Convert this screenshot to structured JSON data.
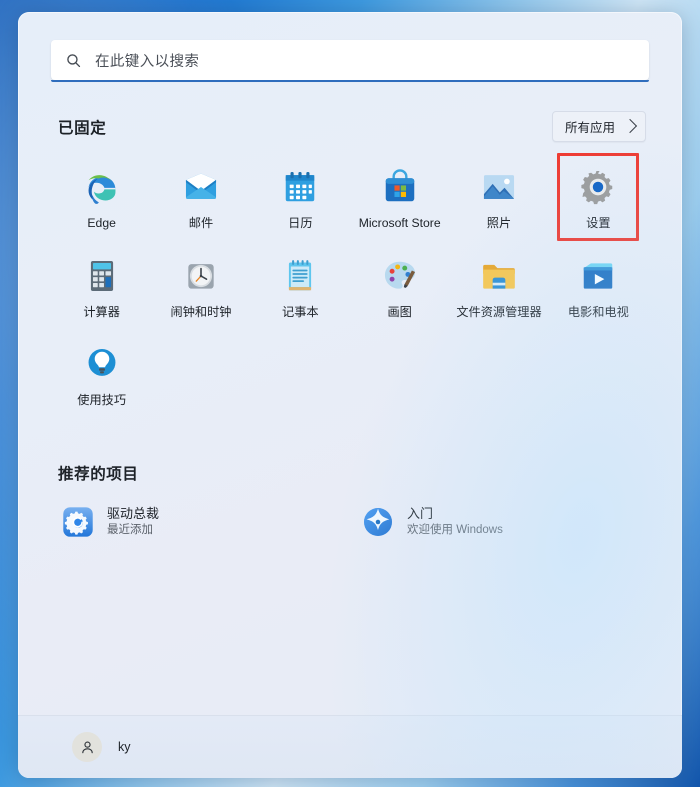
{
  "search": {
    "placeholder": "在此键入以搜索",
    "icon": "search-icon"
  },
  "pinned": {
    "title": "已固定",
    "all_apps_label": "所有应用",
    "all_apps_chevron": "chevron-right-icon",
    "apps": [
      {
        "label": "Edge",
        "icon": "edge-icon",
        "highlighted": false
      },
      {
        "label": "邮件",
        "icon": "mail-icon",
        "highlighted": false
      },
      {
        "label": "日历",
        "icon": "calendar-icon",
        "highlighted": false
      },
      {
        "label": "Microsoft Store",
        "icon": "microsoft-store-icon",
        "highlighted": false
      },
      {
        "label": "照片",
        "icon": "photos-icon",
        "highlighted": false
      },
      {
        "label": "设置",
        "icon": "settings-gear-icon",
        "highlighted": true
      },
      {
        "label": "计算器",
        "icon": "calculator-icon",
        "highlighted": false
      },
      {
        "label": "闹钟和时钟",
        "icon": "clock-icon",
        "highlighted": false
      },
      {
        "label": "记事本",
        "icon": "notepad-icon",
        "highlighted": false
      },
      {
        "label": "画图",
        "icon": "paint-palette-icon",
        "highlighted": false
      },
      {
        "label": "文件资源管理器",
        "icon": "folder-icon",
        "highlighted": false
      },
      {
        "label": "电影和电视",
        "icon": "movies-tv-icon",
        "highlighted": false
      },
      {
        "label": "使用技巧",
        "icon": "lightbulb-tips-icon",
        "highlighted": false
      }
    ]
  },
  "recommended": {
    "title": "推荐的项目",
    "items": [
      {
        "title": "驱动总裁",
        "subtitle": "最近添加",
        "icon": "driver-gear-icon"
      },
      {
        "title": "入门",
        "subtitle": "欢迎使用 Windows",
        "icon": "get-started-star-icon"
      }
    ]
  },
  "user": {
    "name": "ky",
    "avatar_icon": "person-avatar-icon"
  },
  "colors": {
    "highlight_box": "#ee3b33",
    "search_accent": "#2f6dbd",
    "panel_bg": "#e7edf8"
  }
}
